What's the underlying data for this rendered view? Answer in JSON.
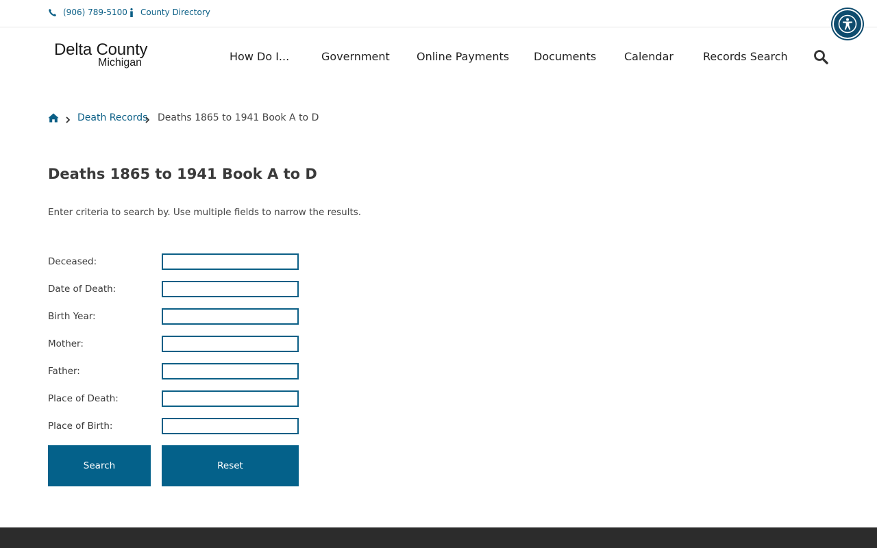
{
  "utility": {
    "phone": "(906) 789-5100",
    "directory": "County Directory"
  },
  "logo": {
    "line1": "Delta County",
    "line2": "Michigan"
  },
  "nav": {
    "items": [
      "How Do I...",
      "Government",
      "Online Payments",
      "Documents",
      "Calendar",
      "Records Search"
    ]
  },
  "breadcrumb": {
    "link": "Death Records",
    "current": "Deaths 1865 to 1941 Book A to D"
  },
  "page": {
    "title": "Deaths 1865 to 1941 Book A to D",
    "intro": "Enter criteria to search by. Use multiple fields to narrow the results."
  },
  "form": {
    "fields": [
      {
        "label": "Deceased:",
        "value": ""
      },
      {
        "label": "Date of Death:",
        "value": ""
      },
      {
        "label": "Birth Year:",
        "value": ""
      },
      {
        "label": "Mother:",
        "value": ""
      },
      {
        "label": "Father:",
        "value": ""
      },
      {
        "label": "Place of Death:",
        "value": ""
      },
      {
        "label": "Place of Birth:",
        "value": ""
      }
    ],
    "search_label": "Search",
    "reset_label": "Reset"
  },
  "icons": {
    "phone": "phone-icon",
    "info": "info-icon",
    "accessibility": "accessibility-icon",
    "search": "search-icon",
    "home": "home-icon",
    "chevron": "chevron-right-icon"
  },
  "colors": {
    "link": "#0b5f86",
    "button": "#04618a",
    "accessibility": "#0f4c6e",
    "footer": "#2c2c2c"
  }
}
